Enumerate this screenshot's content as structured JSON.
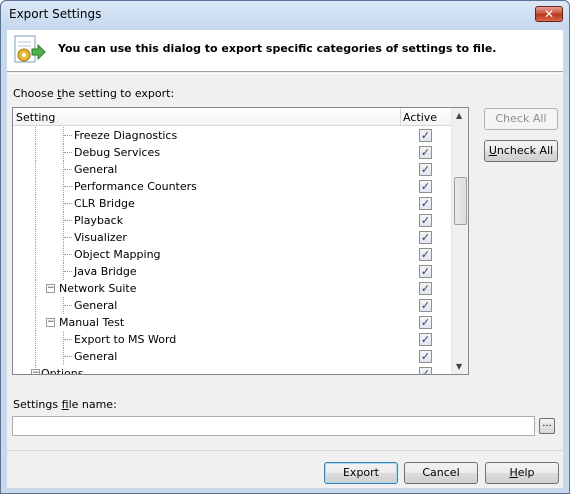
{
  "window": {
    "title": "Export Settings",
    "close_glyph": "✕"
  },
  "banner": {
    "text": "You can use this dialog to export specific categories of settings to file.",
    "icon": "settings-export-icon"
  },
  "choose_label": {
    "pre": "Choose ",
    "accel": "t",
    "post": "he setting to export:"
  },
  "tree": {
    "columns": {
      "setting": "Setting",
      "active": "Active"
    },
    "rows": [
      {
        "label": "Freeze Diagnostics",
        "level": 3,
        "checked": true
      },
      {
        "label": "Debug Services",
        "level": 3,
        "checked": true
      },
      {
        "label": "General",
        "level": 3,
        "checked": true
      },
      {
        "label": "Performance Counters",
        "level": 3,
        "checked": true
      },
      {
        "label": "CLR Bridge",
        "level": 3,
        "checked": true
      },
      {
        "label": "Playback",
        "level": 3,
        "checked": true
      },
      {
        "label": "Visualizer",
        "level": 3,
        "checked": true
      },
      {
        "label": "Object Mapping",
        "level": 3,
        "checked": true
      },
      {
        "label": "Java Bridge",
        "level": 3,
        "checked": true
      },
      {
        "label": "Network Suite",
        "level": 2,
        "checked": true,
        "expander": "⊟"
      },
      {
        "label": "General",
        "level": 3,
        "checked": true
      },
      {
        "label": "Manual Test",
        "level": 2,
        "checked": true,
        "expander": "⊟"
      },
      {
        "label": "Export to MS Word",
        "level": 3,
        "checked": true
      },
      {
        "label": "General",
        "level": 3,
        "checked": true
      },
      {
        "label": "Options",
        "level": 1,
        "checked": true,
        "expander": "⊟"
      }
    ],
    "check_glyph": "✓"
  },
  "buttons": {
    "check_all": "Check All",
    "uncheck_all": {
      "accel": "U",
      "rest": "ncheck All"
    },
    "export": "Export",
    "cancel": "Cancel",
    "help": {
      "accel": "H",
      "rest": "elp"
    },
    "browse": "..."
  },
  "file_label": {
    "pre": "Settings ",
    "accel": "f",
    "post": "ile name:"
  },
  "file_value": ""
}
